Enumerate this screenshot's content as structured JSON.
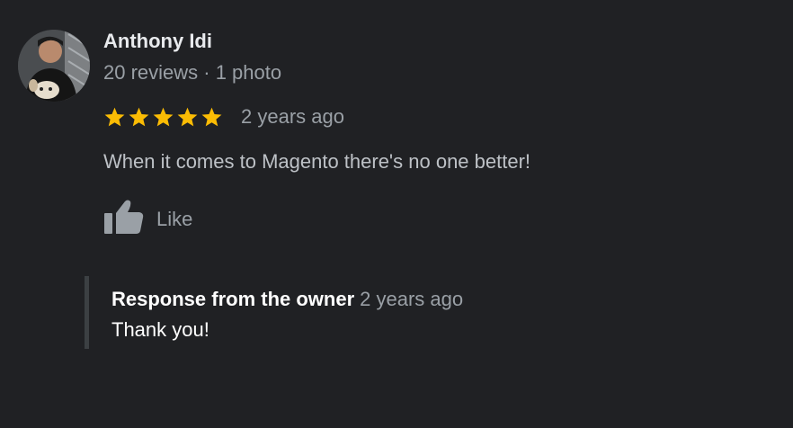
{
  "reviewer": {
    "name": "Anthony Idi",
    "meta": "20 reviews · 1 photo",
    "avatar_icon": "user-photo-avatar"
  },
  "review": {
    "rating": 5,
    "max_rating": 5,
    "date": "2 years ago",
    "text": "When it comes to Magento there's no one better!",
    "star_color": "#fbbc04"
  },
  "actions": {
    "like_label": "Like",
    "like_icon": "thumbs-up-icon"
  },
  "owner_response": {
    "title": "Response from the owner",
    "date": "2 years ago",
    "text": "Thank you!"
  }
}
